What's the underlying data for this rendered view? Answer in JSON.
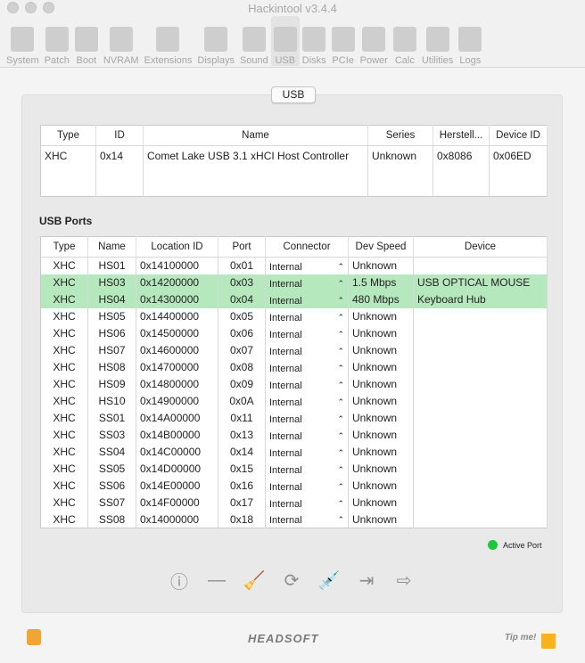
{
  "window": {
    "title": "Hackintool v3.4.4"
  },
  "toolbar": [
    {
      "label": "System"
    },
    {
      "label": "Patch"
    },
    {
      "label": "Boot"
    },
    {
      "label": "NVRAM"
    },
    {
      "label": "Extensions"
    },
    {
      "label": "Displays"
    },
    {
      "label": "Sound"
    },
    {
      "label": "USB",
      "active": true
    },
    {
      "label": "Disks"
    },
    {
      "label": "PCIe"
    },
    {
      "label": "Power"
    },
    {
      "label": "Calc"
    },
    {
      "label": "Utilities"
    },
    {
      "label": "Logs"
    }
  ],
  "segment": "USB",
  "controllers": {
    "headers": [
      "Type",
      "ID",
      "Name",
      "Series",
      "Herstell...",
      "Device ID"
    ],
    "rows": [
      [
        "XHC",
        "0x14",
        "Comet Lake USB 3.1 xHCI Host Controller",
        "Unknown",
        "0x8086",
        "0x06ED"
      ]
    ]
  },
  "ports_title": "USB Ports",
  "ports": {
    "headers": [
      "Type",
      "Name",
      "Location ID",
      "Port",
      "Connector",
      "Dev Speed",
      "Device"
    ],
    "rows": [
      [
        "XHC",
        "HS01",
        "0x14100000",
        "0x01",
        "Internal",
        "Unknown",
        ""
      ],
      [
        "XHC",
        "HS03",
        "0x14200000",
        "0x03",
        "Internal",
        "1.5 Mbps",
        "USB OPTICAL MOUSE"
      ],
      [
        "XHC",
        "HS04",
        "0x14300000",
        "0x04",
        "Internal",
        "480 Mbps",
        "Keyboard Hub"
      ],
      [
        "XHC",
        "HS05",
        "0x14400000",
        "0x05",
        "Internal",
        "Unknown",
        ""
      ],
      [
        "XHC",
        "HS06",
        "0x14500000",
        "0x06",
        "Internal",
        "Unknown",
        ""
      ],
      [
        "XHC",
        "HS07",
        "0x14600000",
        "0x07",
        "Internal",
        "Unknown",
        ""
      ],
      [
        "XHC",
        "HS08",
        "0x14700000",
        "0x08",
        "Internal",
        "Unknown",
        ""
      ],
      [
        "XHC",
        "HS09",
        "0x14800000",
        "0x09",
        "Internal",
        "Unknown",
        ""
      ],
      [
        "XHC",
        "HS10",
        "0x14900000",
        "0x0A",
        "Internal",
        "Unknown",
        ""
      ],
      [
        "XHC",
        "SS01",
        "0x14A00000",
        "0x11",
        "Internal",
        "Unknown",
        ""
      ],
      [
        "XHC",
        "SS03",
        "0x14B00000",
        "0x13",
        "Internal",
        "Unknown",
        ""
      ],
      [
        "XHC",
        "SS04",
        "0x14C00000",
        "0x14",
        "Internal",
        "Unknown",
        ""
      ],
      [
        "XHC",
        "SS05",
        "0x14D00000",
        "0x15",
        "Internal",
        "Unknown",
        ""
      ],
      [
        "XHC",
        "SS06",
        "0x14E00000",
        "0x16",
        "Internal",
        "Unknown",
        ""
      ],
      [
        "XHC",
        "SS07",
        "0x14F00000",
        "0x17",
        "Internal",
        "Unknown",
        ""
      ],
      [
        "XHC",
        "SS08",
        "0x14000000",
        "0x18",
        "Internal",
        "Unknown",
        ""
      ]
    ],
    "active_rows": [
      1,
      2
    ]
  },
  "legend": {
    "label": "Active Port",
    "color": "#1ec63c"
  },
  "actions": [
    {
      "icon": "info-icon",
      "glyph": "ⓘ"
    },
    {
      "icon": "minus-icon",
      "glyph": "—"
    },
    {
      "icon": "broom-icon",
      "glyph": "🧹"
    },
    {
      "icon": "refresh-icon",
      "glyph": "⟳"
    },
    {
      "icon": "syringe-icon",
      "glyph": "💉"
    },
    {
      "icon": "import-icon",
      "glyph": "⇥"
    },
    {
      "icon": "export-icon",
      "glyph": "⇨"
    }
  ],
  "footer": {
    "brand": "HEADSOFT",
    "tip": "Tip me!"
  }
}
